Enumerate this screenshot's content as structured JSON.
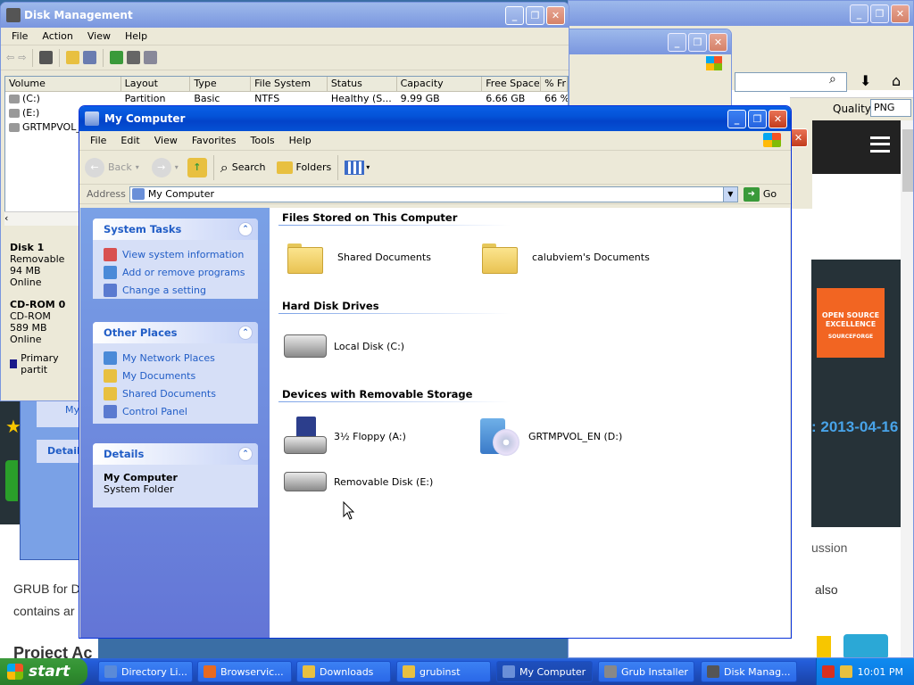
{
  "browser": {
    "quality_label": "Quality",
    "quality_value": "PNG",
    "date_text": ": 2013-04-16",
    "discussion_text": "ussion",
    "grub_text": "GRUB for D",
    "contains_text": "contains ar",
    "also_text": "also",
    "project_text": "Project Ac",
    "badge_line1": "OPEN SOURCE",
    "badge_line2": "EXCELLENCE",
    "badge_line3": "SOURCEFORGE",
    "colors": {
      "accent": "#1a73a8",
      "badge": "#f26522"
    }
  },
  "disk_mgmt": {
    "title": "Disk Management",
    "menu": [
      "File",
      "Action",
      "View",
      "Help"
    ],
    "columns": [
      "Volume",
      "Layout",
      "Type",
      "File System",
      "Status",
      "Capacity",
      "Free Space",
      "% Fr"
    ],
    "rows": [
      [
        "(C:)",
        "Partition",
        "Basic",
        "NTFS",
        "Healthy (S...",
        "9.99 GB",
        "6.66 GB",
        "66 %"
      ],
      [
        "(E:)",
        "",
        "",
        "",
        "",
        "",
        "",
        ""
      ],
      [
        "GRTMPVOL_E",
        "",
        "",
        "",
        "",
        "",
        "",
        ""
      ]
    ],
    "disk1": {
      "name": "Disk 1",
      "type": "Removable",
      "size": "94 MB",
      "state": "Online"
    },
    "cdrom": {
      "name": "CD-ROM 0",
      "type": "CD-ROM",
      "size": "589 MB",
      "state": "Online"
    },
    "legend": "Primary partit"
  },
  "behind_window": {
    "my_text": "My",
    "details_text": "Details"
  },
  "mycomputer": {
    "title": "My Computer",
    "menu": [
      "File",
      "Edit",
      "View",
      "Favorites",
      "Tools",
      "Help"
    ],
    "toolbar": {
      "back": "Back",
      "search": "Search",
      "folders": "Folders"
    },
    "address_label": "Address",
    "address_value": "My Computer",
    "go_label": "Go",
    "system_tasks": {
      "title": "System Tasks",
      "items": [
        "View system information",
        "Add or remove programs",
        "Change a setting"
      ]
    },
    "other_places": {
      "title": "Other Places",
      "items": [
        "My Network Places",
        "My Documents",
        "Shared Documents",
        "Control Panel"
      ]
    },
    "details": {
      "title": "Details",
      "name": "My Computer",
      "desc": "System Folder"
    },
    "sections": {
      "files": "Files Stored on This Computer",
      "hdd": "Hard Disk Drives",
      "removable": "Devices with Removable Storage"
    },
    "items": {
      "shared_docs": "Shared Documents",
      "user_docs": "calubviem's Documents",
      "local_disk": "Local Disk (C:)",
      "floppy": "3½ Floppy (A:)",
      "cd": "GRTMPVOL_EN (D:)",
      "removable": "Removable Disk (E:)"
    }
  },
  "taskbar": {
    "start": "start",
    "tasks": [
      "Directory Li...",
      "Browservic...",
      "Downloads",
      "grubinst",
      "My Computer",
      "Grub Installer",
      "Disk Manag..."
    ],
    "active_index": 4,
    "clock": "10:01 PM"
  }
}
